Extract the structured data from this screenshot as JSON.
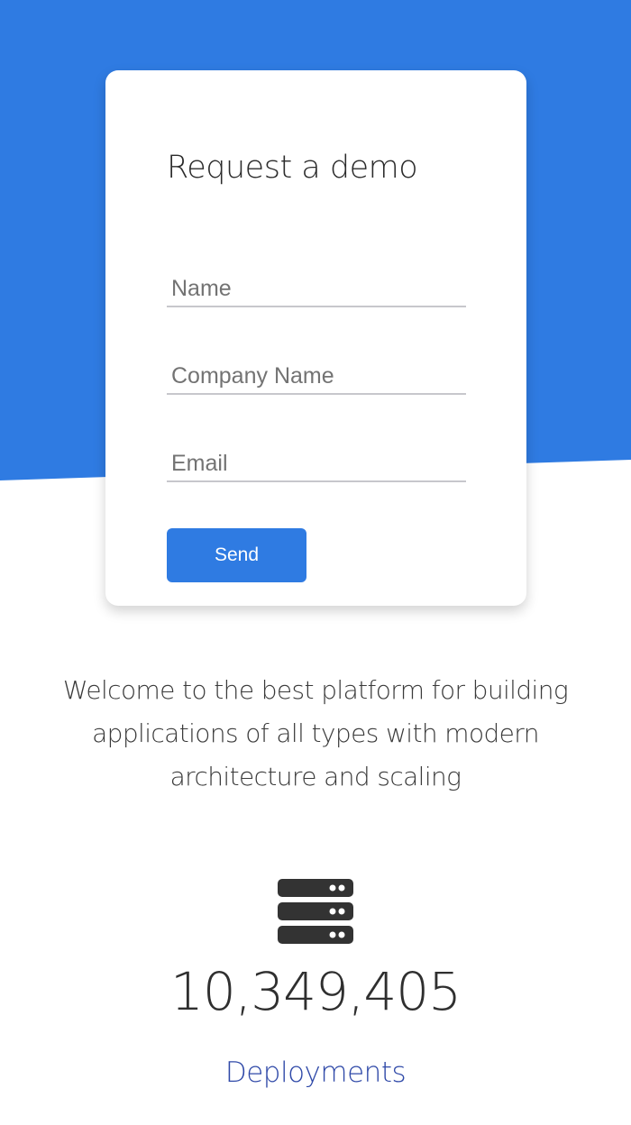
{
  "colors": {
    "hero_bg": "#2f7be2",
    "button_bg": "#2f7be2",
    "button_text": "#ffffff",
    "label_link": "#2f49a8"
  },
  "demo_form": {
    "title": "Request a demo",
    "name_placeholder": "Name",
    "company_placeholder": "Company Name",
    "email_placeholder": "Email",
    "name_value": "",
    "company_value": "",
    "email_value": "",
    "send_label": "Send"
  },
  "intro": {
    "text": "Welcome to the best platform for building applications of all types with modern architecture and scaling"
  },
  "stat": {
    "icon": "server-icon",
    "value": "10,349,405",
    "label": "Deployments"
  }
}
